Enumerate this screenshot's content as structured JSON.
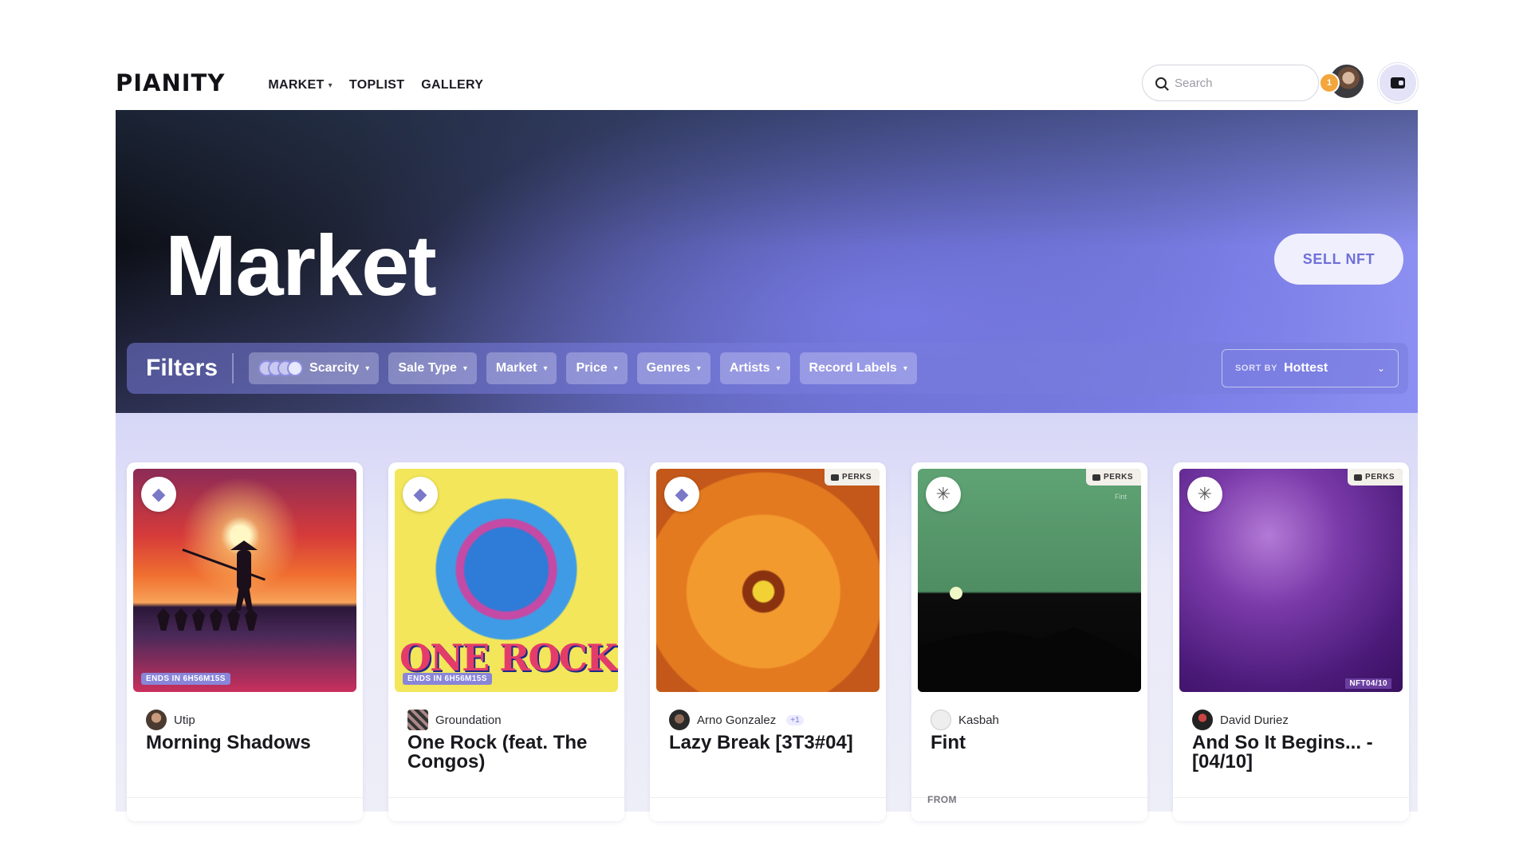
{
  "header": {
    "logo": "PIANITY",
    "nav": [
      {
        "label": "MARKET",
        "has_dropdown": true
      },
      {
        "label": "TOPLIST",
        "has_dropdown": false
      },
      {
        "label": "GALLERY",
        "has_dropdown": false
      }
    ],
    "search_placeholder": "Search",
    "notification_count": "1"
  },
  "hero": {
    "title": "Market",
    "sell_button": "SELL NFT"
  },
  "filters": {
    "title": "Filters",
    "chips": [
      {
        "label": "Scarcity"
      },
      {
        "label": "Sale Type"
      },
      {
        "label": "Market"
      },
      {
        "label": "Price"
      },
      {
        "label": "Genres"
      },
      {
        "label": "Artists"
      },
      {
        "label": "Record Labels"
      }
    ],
    "sort_label": "SORT BY",
    "sort_value": "Hottest"
  },
  "cards": [
    {
      "artist": "Utip",
      "title": "Morning Shadows",
      "ends": "ENDS IN 6H56M15S",
      "perks": "",
      "extra": ""
    },
    {
      "artist": "Groundation",
      "title": "One Rock (feat. The Congos)",
      "ends": "ENDS IN 6H56M15S",
      "perks": "",
      "extra": "ONE ROCK"
    },
    {
      "artist": "Arno Gonzalez",
      "title": "Lazy Break [3T3#04]",
      "ends": "",
      "perks": "PERKS",
      "extra": "+1"
    },
    {
      "artist": "Kasbah",
      "title": "Fint",
      "ends": "",
      "perks": "PERKS",
      "extra": "Fint",
      "from": "FROM"
    },
    {
      "artist": "David Duriez",
      "title": "And So It Begins... - [04/10]",
      "ends": "",
      "perks": "PERKS",
      "extra": "NFT04/10"
    }
  ],
  "colors": {
    "accent": "#6f70d8",
    "badge": "#8985d9",
    "notification": "#f3a63b"
  }
}
